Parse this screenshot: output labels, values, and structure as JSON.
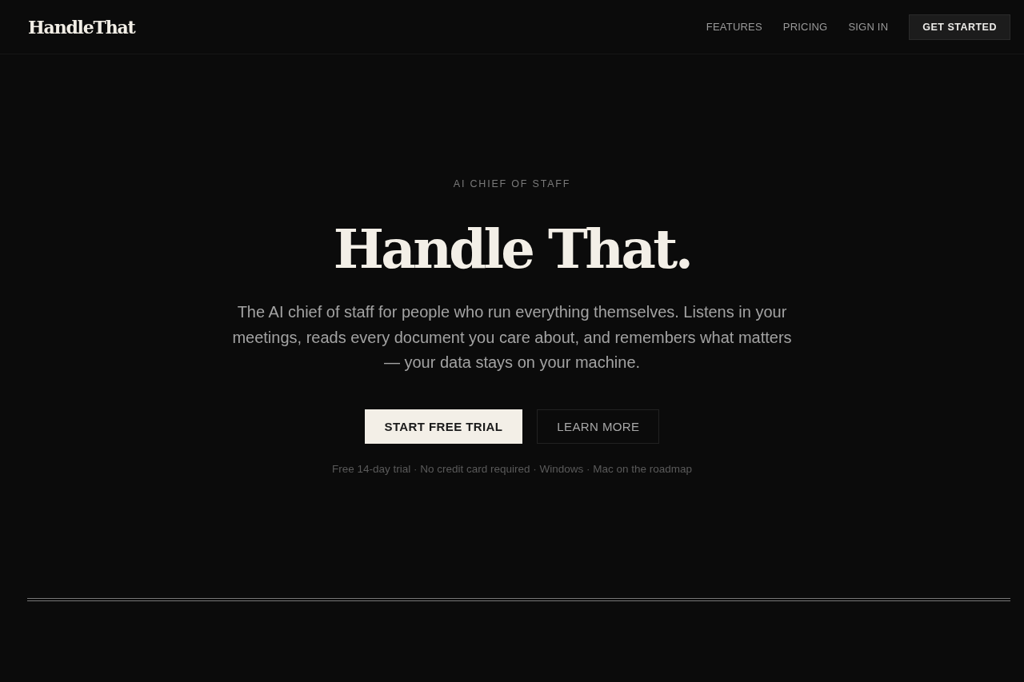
{
  "header": {
    "logo": "HandleThat",
    "nav": [
      "FEATURES",
      "PRICING",
      "SIGN IN"
    ],
    "cta": "GET STARTED"
  },
  "hero": {
    "eyebrow": "AI CHIEF OF STAFF",
    "title": "Handle That.",
    "description": "The AI chief of staff for people who run everything themselves. Listens in your meetings, reads every document you care about, and remembers what matters — your data stays on your machine.",
    "buttons": [
      {
        "label": "START FREE TRIAL",
        "kind": "primary"
      },
      {
        "label": "LEARN MORE",
        "kind": "secondary"
      }
    ],
    "note": "Free 14-day trial · No credit card required · Windows · Mac on the roadmap"
  }
}
